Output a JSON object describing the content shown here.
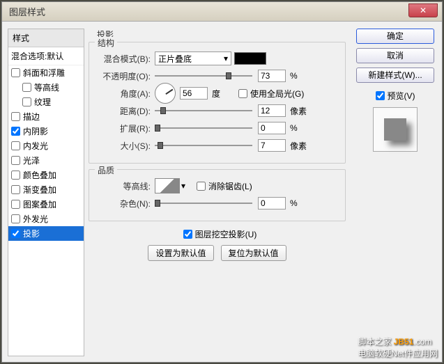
{
  "window": {
    "title": "图层样式",
    "close_icon": "✕"
  },
  "sidebar": {
    "header": "样式",
    "blend_default": "混合选项:默认",
    "items": [
      {
        "label": "斜面和浮雕",
        "checked": false,
        "indent": false
      },
      {
        "label": "等高线",
        "checked": false,
        "indent": true
      },
      {
        "label": "纹理",
        "checked": false,
        "indent": true
      },
      {
        "label": "描边",
        "checked": false,
        "indent": false
      },
      {
        "label": "内阴影",
        "checked": true,
        "indent": false
      },
      {
        "label": "内发光",
        "checked": false,
        "indent": false
      },
      {
        "label": "光泽",
        "checked": false,
        "indent": false
      },
      {
        "label": "颜色叠加",
        "checked": false,
        "indent": false
      },
      {
        "label": "渐变叠加",
        "checked": false,
        "indent": false
      },
      {
        "label": "图案叠加",
        "checked": false,
        "indent": false
      },
      {
        "label": "外发光",
        "checked": false,
        "indent": false
      },
      {
        "label": "投影",
        "checked": true,
        "indent": false,
        "selected": true
      }
    ]
  },
  "main": {
    "title": "投影",
    "structure": {
      "legend": "结构",
      "blend_mode_label": "混合模式(B):",
      "blend_mode_value": "正片叠底",
      "opacity_label": "不透明度(O):",
      "opacity_value": "73",
      "opacity_unit": "%",
      "angle_label": "角度(A):",
      "angle_value": "56",
      "angle_unit": "度",
      "global_light_label": "使用全局光(G)",
      "global_light_checked": false,
      "distance_label": "距离(D):",
      "distance_value": "12",
      "distance_unit": "像素",
      "spread_label": "扩展(R):",
      "spread_value": "0",
      "spread_unit": "%",
      "size_label": "大小(S):",
      "size_value": "7",
      "size_unit": "像素"
    },
    "quality": {
      "legend": "品质",
      "contour_label": "等高线:",
      "antialias_label": "消除锯齿(L)",
      "antialias_checked": false,
      "noise_label": "杂色(N):",
      "noise_value": "0",
      "noise_unit": "%"
    },
    "knockout_label": "图层挖空投影(U)",
    "knockout_checked": true,
    "set_default": "设置为默认值",
    "reset_default": "复位为默认值"
  },
  "buttons": {
    "ok": "确定",
    "cancel": "取消",
    "new_style": "新建样式(W)...",
    "preview": "预览(V)",
    "preview_checked": true
  },
  "watermark": {
    "line1": "脚本之家",
    "line2": "电脑软硬Net件应用网",
    "accent": "JB51",
    "suffix": ".com"
  }
}
